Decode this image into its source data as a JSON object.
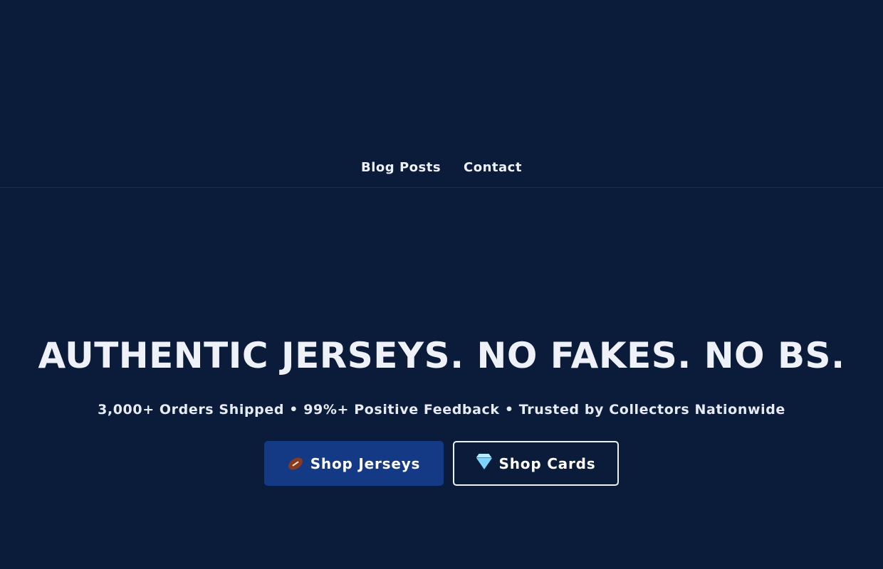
{
  "nav": {
    "links": [
      {
        "label": "Blog Posts"
      },
      {
        "label": "Contact"
      }
    ]
  },
  "hero": {
    "headline": "AUTHENTIC JERSEYS. NO FAKES. NO BS.",
    "subhead": "3,000+ Orders Shipped • 99%+ Positive Feedback • Trusted by Collectors Nationwide",
    "buttons": [
      {
        "label": "Shop Jerseys",
        "icon": "football-icon"
      },
      {
        "label": "Shop Cards",
        "icon": "gem-icon"
      }
    ]
  },
  "colors": {
    "background": "#0b1b3a",
    "primary_button": "#143a85",
    "text": "#eef2f8"
  }
}
